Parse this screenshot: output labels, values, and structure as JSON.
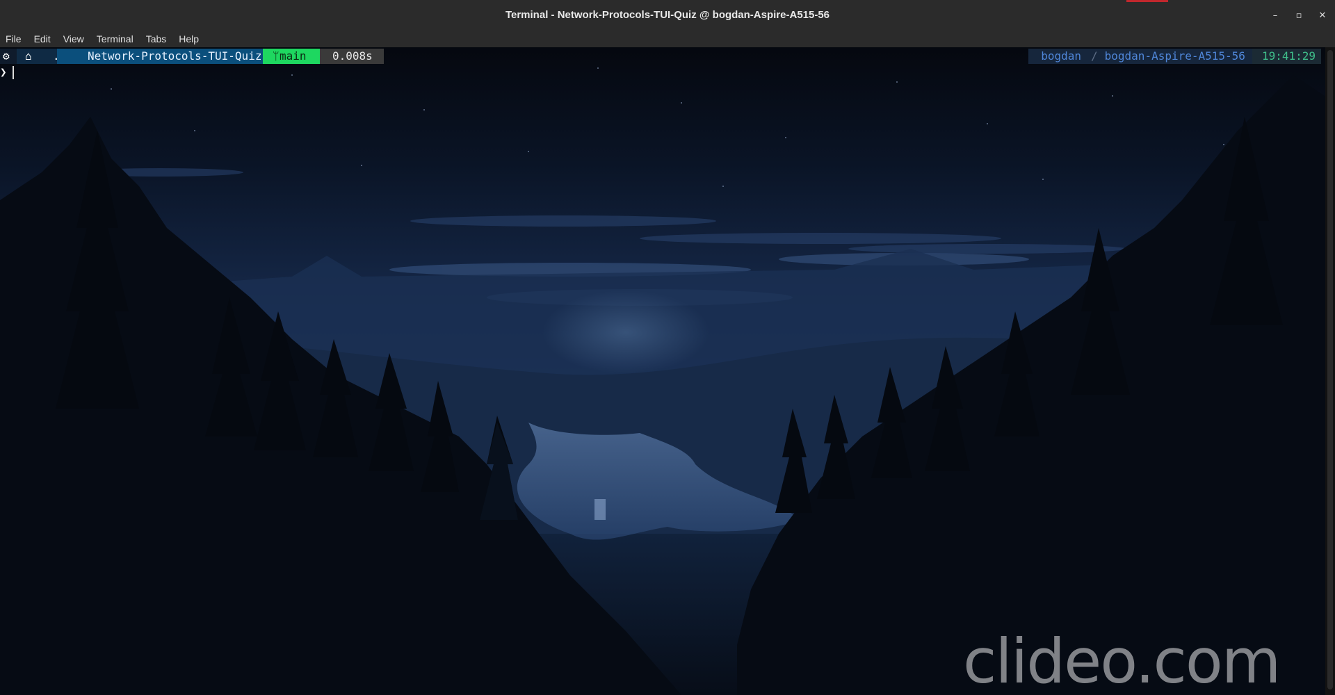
{
  "window": {
    "title": "Terminal - Network-Protocols-TUI-Quiz @ bogdan-Aspire-A515-56",
    "controls": [
      "minimize-icon",
      "maximize-icon",
      "close-icon"
    ],
    "control_glyphs": [
      "–",
      "▫",
      "✕"
    ]
  },
  "menu": [
    "File",
    "Edit",
    "View",
    "Terminal",
    "Tabs",
    "Help"
  ],
  "prompt": {
    "os_glyph": "⚙",
    "home_glyph": "⌂",
    "ellipsis": "...",
    "path": "Network-Protocols-TUI-Quiz",
    "git_glyph": "ᛘ",
    "branch": "main",
    "duration": "0.008s",
    "prompt_char": "❯"
  },
  "right_prompt": {
    "user": "bogdan",
    "separator": "/",
    "host": "bogdan-Aspire-A515-56",
    "clock": "19:41:29"
  },
  "watermark": "clideo.com",
  "colors": {
    "git_segment": "#1ed760",
    "path_segment": "#0b4f7c",
    "clock_text": "#3fbf8b",
    "user_text": "#4f86d8"
  }
}
